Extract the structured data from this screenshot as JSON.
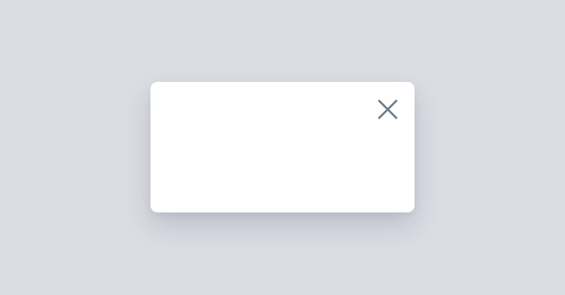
{
  "colors": {
    "backdrop": "#dbdde4",
    "modal_background": "#ffffff",
    "close_icon": "#6e7a8c"
  },
  "dialog": {
    "close_icon": "close-icon"
  }
}
